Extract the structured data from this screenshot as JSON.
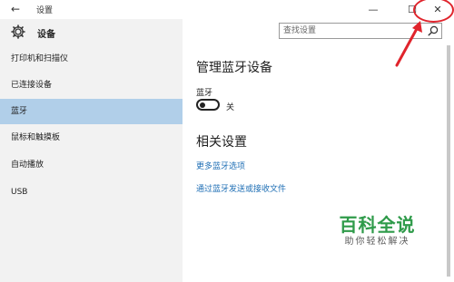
{
  "window": {
    "title": "设置",
    "back_icon": "←",
    "minimize_icon": "—",
    "maximize_icon": "☐",
    "close_icon": "✕"
  },
  "header": {
    "app_title": "设备",
    "search_placeholder": "查找设置"
  },
  "sidebar": {
    "items": [
      {
        "label": "打印机和扫描仪"
      },
      {
        "label": "已连接设备"
      },
      {
        "label": "蓝牙"
      },
      {
        "label": "鼠标和触摸板"
      },
      {
        "label": "自动播放"
      },
      {
        "label": "USB"
      }
    ],
    "active_index": 2
  },
  "main": {
    "heading": "管理蓝牙设备",
    "toggle_label": "蓝牙",
    "toggle_state": "关",
    "toggle_on": false,
    "related_heading": "相关设置",
    "links": [
      {
        "label": "更多蓝牙选项"
      },
      {
        "label": "通过蓝牙发送或接收文件"
      }
    ]
  },
  "watermark": {
    "main": "百科全说",
    "sub": "助你轻松解决"
  },
  "colors": {
    "accent": "#1f6fb5",
    "active_nav": "#b1cfe9",
    "highlight": "#e0242c",
    "watermark_green": "#2f9b4a"
  }
}
